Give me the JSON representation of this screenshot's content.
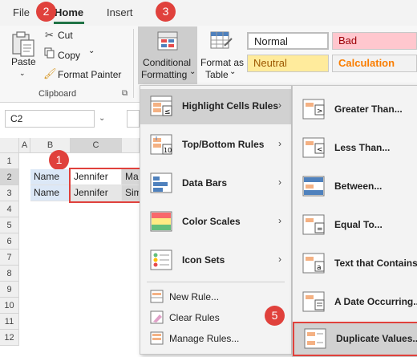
{
  "tabs": {
    "file": "File",
    "home": "Home",
    "insert": "Insert"
  },
  "badges": {
    "b1": "1",
    "b2": "2",
    "b3": "3",
    "b5": "5"
  },
  "clipboard": {
    "paste": "Paste",
    "cut": "Cut",
    "copy": "Copy",
    "format_painter": "Format Painter",
    "group_label": "Clipboard"
  },
  "styles_group": {
    "conditional_formatting_line1": "Conditional",
    "conditional_formatting_line2": "Formatting",
    "format_as_table_line1": "Format as",
    "format_as_table_line2": "Table",
    "normal": "Normal",
    "bad": "Bad",
    "neutral": "Neutral",
    "calculation": "Calculation"
  },
  "name_box": "C2",
  "grid": {
    "col_headers": [
      "A",
      "B",
      "C"
    ],
    "row_headers": [
      "1",
      "2",
      "3",
      "4",
      "5",
      "6",
      "7",
      "8",
      "9",
      "10",
      "11",
      "12"
    ],
    "rows": [
      {
        "b": "Name",
        "c": "Jennifer",
        "d": "Ma"
      },
      {
        "b": "Name",
        "c": "Jennifer",
        "d": "Sim"
      }
    ]
  },
  "cf_menu": {
    "items": [
      {
        "label": "Highlight Cells Rules",
        "key": "H",
        "has_submenu": true
      },
      {
        "label": "Top/Bottom Rules",
        "key": "T",
        "has_submenu": true
      },
      {
        "label": "Data Bars",
        "key": "D",
        "has_submenu": true
      },
      {
        "label": "Color Scales",
        "key": "S",
        "has_submenu": true
      },
      {
        "label": "Icon Sets",
        "key": "I",
        "has_submenu": true
      },
      {
        "label": "New Rule...",
        "key": "N",
        "has_submenu": false
      },
      {
        "label": "Clear Rules",
        "key": "C",
        "has_submenu": true
      },
      {
        "label": "Manage Rules...",
        "key": "R",
        "has_submenu": false
      }
    ]
  },
  "hcr_menu": {
    "items": [
      {
        "label": "Greater Than...",
        "key": "G"
      },
      {
        "label": "Less Than...",
        "key": "L"
      },
      {
        "label": "Between...",
        "key": "B"
      },
      {
        "label": "Equal To...",
        "key": "E"
      },
      {
        "label": "Text that Contains...",
        "key": "T"
      },
      {
        "label": "A Date Occurring...",
        "key": "A"
      },
      {
        "label": "Duplicate Values...",
        "key": "D"
      }
    ]
  },
  "colors": {
    "accent_green": "#217346",
    "badge_red": "#e0413c",
    "highlight_border": "#e0413c",
    "bad_bg": "#ffc7ce",
    "bad_text": "#9c0006",
    "neutral_bg": "#ffeb9c",
    "neutral_text": "#9c5700",
    "calc_bg": "#f2f2f2",
    "calc_text": "#fa7d00"
  }
}
